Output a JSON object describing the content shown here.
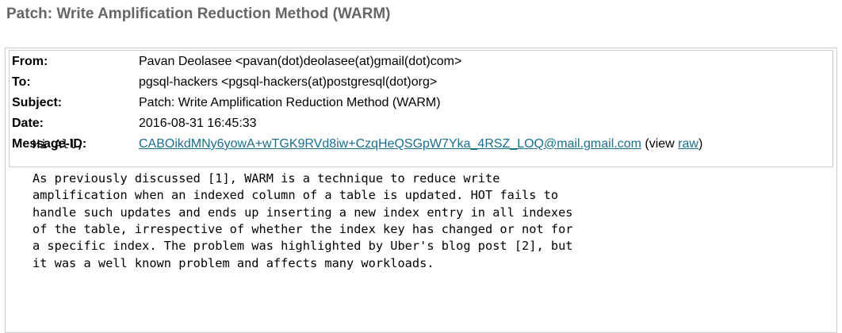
{
  "page": {
    "title": "Patch: Write Amplification Reduction Method (WARM)"
  },
  "headers": {
    "from_label": "From:",
    "from_value": "Pavan Deolasee <pavan(dot)deolasee(at)gmail(dot)com>",
    "to_label": "To:",
    "to_value": "pgsql-hackers <pgsql-hackers(at)postgresql(dot)org>",
    "subject_label": "Subject:",
    "subject_value": "Patch: Write Amplification Reduction Method (WARM)",
    "date_label": "Date:",
    "date_value": "2016-08-31 16:45:33",
    "message_id_label": "Message-ID:",
    "message_id_value": "CABOikdMNy6yowA+wTGK9RVd8iw+CzqHeQSGpW7Yka_4RSZ_LOQ@mail.gmail.com",
    "view_prefix": " (view ",
    "raw_link": "raw",
    "view_suffix": ")"
  },
  "body": {
    "lines": [
      "Hi All,",
      "",
      "As previously discussed [1], WARM is a technique to reduce write",
      "amplification when an indexed column of a table is updated. HOT fails to",
      "handle such updates and ends up inserting a new index entry in all indexes",
      "of the table, irrespective of whether the index key has changed or not for",
      "a specific index. The problem was highlighted by Uber's blog post [2], but",
      "it was a well known problem and affects many workloads."
    ]
  },
  "colors": {
    "title": "#666666",
    "link": "#1a6e8f",
    "border": "#cccccc"
  }
}
